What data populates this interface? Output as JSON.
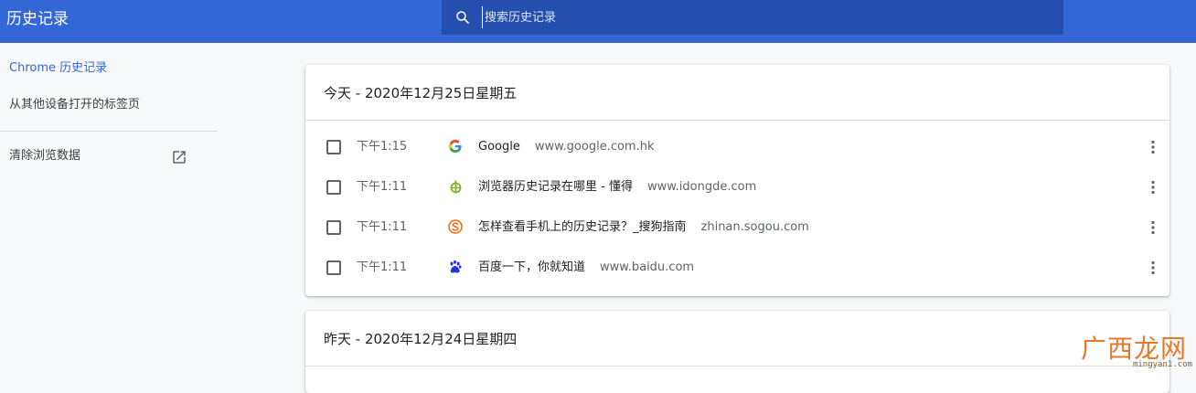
{
  "header": {
    "title": "历史记录",
    "search_placeholder": "搜索历史记录",
    "search_value": ""
  },
  "sidebar": {
    "items": [
      {
        "label": "Chrome 历史记录",
        "active": true
      },
      {
        "label": "从其他设备打开的标签页",
        "active": false
      },
      {
        "label": "清除浏览数据",
        "active": false,
        "icon": "open-in-new-icon"
      }
    ]
  },
  "cards": [
    {
      "date": "今天 - 2020年12月25日星期五",
      "entries": [
        {
          "time": "下午1:15",
          "title": "Google",
          "domain": "www.google.com.hk",
          "favicon": "google-icon"
        },
        {
          "time": "下午1:11",
          "title": "浏览器历史记录在哪里 - 懂得",
          "domain": "www.idongde.com",
          "favicon": "idongde-icon"
        },
        {
          "time": "下午1:11",
          "title": "怎样查看手机上的历史记录？_搜狗指南",
          "domain": "zhinan.sogou.com",
          "favicon": "sogou-icon"
        },
        {
          "time": "下午1:11",
          "title": "百度一下，你就知道",
          "domain": "www.baidu.com",
          "favicon": "baidu-icon"
        }
      ]
    },
    {
      "date": "昨天 - 2020年12月24日星期四",
      "entries": []
    }
  ],
  "watermark": {
    "logo_text": "广西龙网",
    "url": "mingyan1.com"
  },
  "colors": {
    "header_bg": "#3367d6",
    "search_bg": "#254fae",
    "accent": "#3367d6",
    "page_bg": "#f8f9fa"
  }
}
